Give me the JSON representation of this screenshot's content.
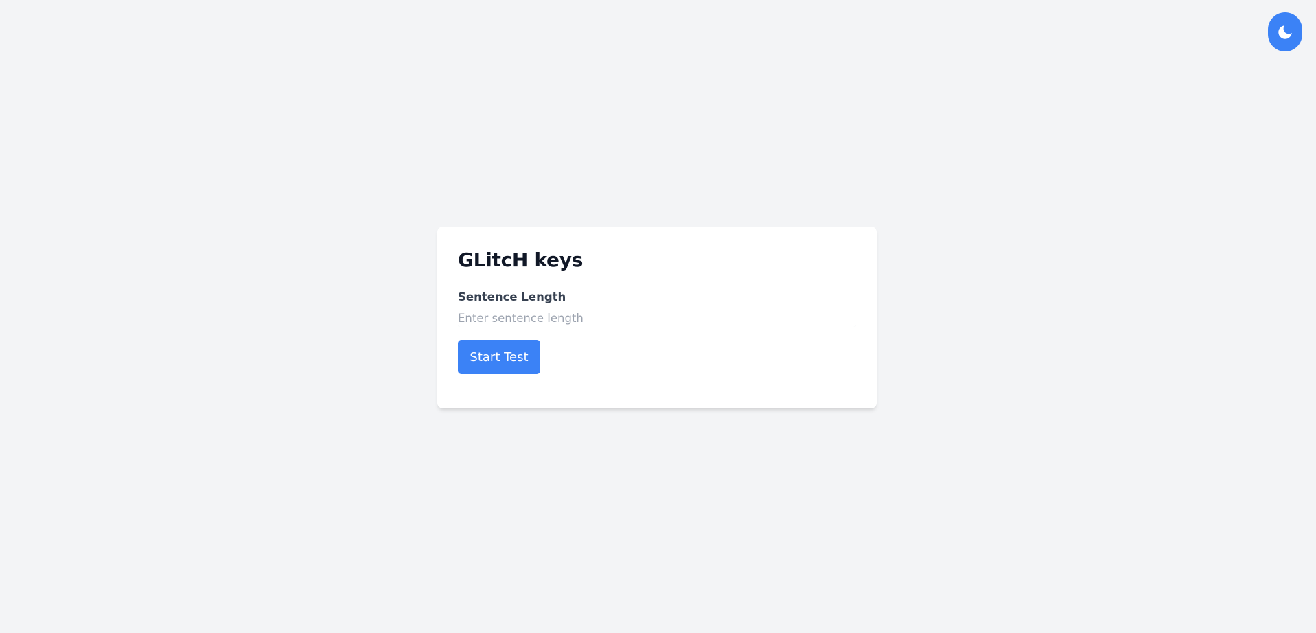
{
  "theme_toggle": {
    "icon": "moon-icon",
    "color": "#3b82f6"
  },
  "card": {
    "title": "GLitcH keys",
    "sentence_length": {
      "label": "Sentence Length",
      "placeholder": "Enter sentence length",
      "value": ""
    },
    "start_button_label": "Start Test"
  },
  "colors": {
    "background": "#f3f4f6",
    "accent": "#3b82f6",
    "card": "#ffffff"
  }
}
